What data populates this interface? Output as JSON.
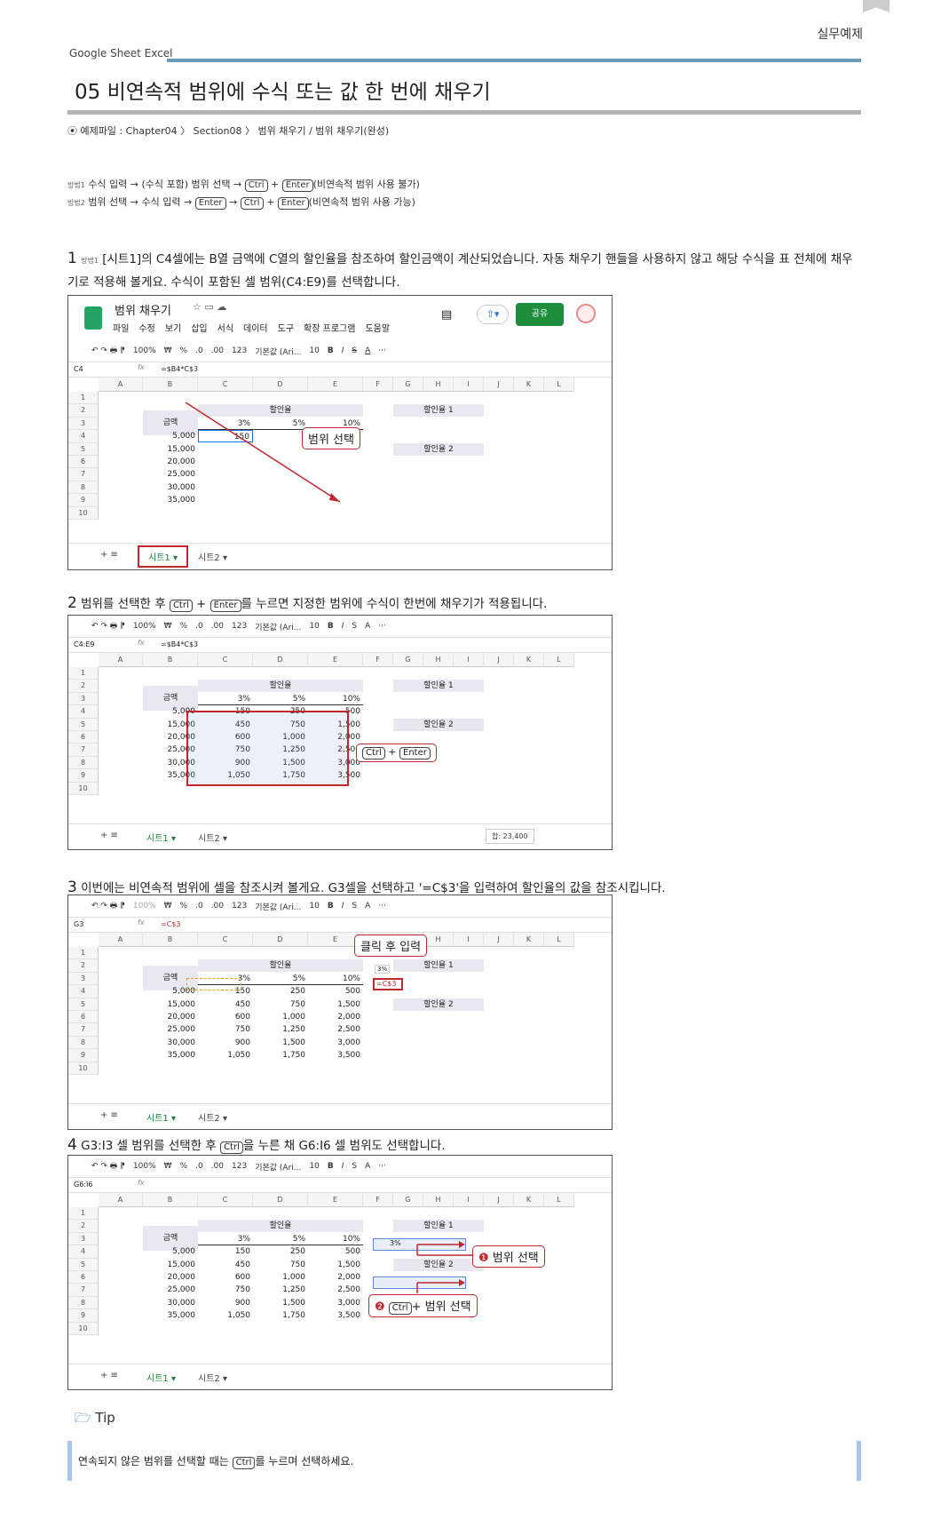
{
  "header": {
    "section": "실무예제",
    "crumb": "Google Sheet  Excel",
    "title": "05 비연속적 범위에 수식 또는 값 한 번에 채우기",
    "file": "⦿ 예제파일 : Chapter04 〉 Section08 〉 범위 채우기 / 범위 채우기(완성)"
  },
  "methods": [
    {
      "tag": "방법1",
      "text1": "수식 입력 → (수식 포함) 범위 선택 →",
      "k1": "Ctrl",
      "plus": "+",
      "k2": "Enter",
      "text2": "(비연속적 범위 사용 불가)"
    },
    {
      "tag": "방법2",
      "text1": "범위 선택 → 수식 입력 →",
      "k1": "Enter",
      "arrow": "→",
      "k2": "Ctrl",
      "plus": "+",
      "k3": "Enter",
      "text2": "(비연속적 범위 사용 가능)"
    }
  ],
  "steps": [
    {
      "num": "1",
      "tag": "방법1",
      "text": "[시트1]의 C4셀에는 B열 금액에 C열의 할인율을 참조하여 할인금액이 계산되었습니다. 자동 채우기 핸들을 사용하지 않고 해당 수식을 표 전체에 채우기로 적용해 볼게요. 수식이 포함된 셀 범위(C4:E9)를 선택합니다."
    },
    {
      "num": "2",
      "a": "범위를 선택한 후",
      "k1": "Ctrl",
      "plus": "+",
      "k2": "Enter",
      "b": "를 누르면 지정한 범위에 수식이 한번에 채우기가 적용됩니다."
    },
    {
      "num": "3",
      "text": "이번에는 비연속적 범위에 셀을 참조시켜 볼게요. G3셀을 선택하고 '=C$3'을 입력하여 할인율의 값을 참조시킵니다."
    },
    {
      "num": "4",
      "a": "G3:I3 셀 범위를 선택한 후",
      "k1": "Ctrl",
      "b": "을 누른 채 G6:I6 셀 범위도 선택합니다."
    }
  ],
  "app": {
    "doc_title": "범위 채우기",
    "menu": [
      "파일",
      "수정",
      "보기",
      "삽입",
      "서식",
      "데이터",
      "도구",
      "확장 프로그램",
      "도움말"
    ],
    "share": "공유",
    "zoom": "100%",
    "font": "기본값 (Ari...",
    "size": "10",
    "currency": "₩",
    "percent": "%",
    "dec1": ".0",
    "dec2": ".00",
    "num": "123"
  },
  "sheet_tabs": {
    "tab1": "시트1",
    "tab2": "시트2",
    "sum": "합: 23,400"
  },
  "cols": [
    "A",
    "B",
    "C",
    "D",
    "E",
    "F",
    "G",
    "H",
    "I",
    "J",
    "K",
    "L"
  ],
  "rows": [
    "1",
    "2",
    "3",
    "4",
    "5",
    "6",
    "7",
    "8",
    "9",
    "10"
  ],
  "table": {
    "amount_label": "금액",
    "rate_label": "할인율",
    "rates": [
      "3%",
      "5%",
      "10%"
    ],
    "amounts": [
      "5,000",
      "15,000",
      "20,000",
      "25,000",
      "30,000",
      "35,000"
    ],
    "c": [
      "150",
      "450",
      "600",
      "750",
      "900",
      "1,050"
    ],
    "d": [
      "250",
      "750",
      "1,000",
      "1,250",
      "1,500",
      "1,750"
    ],
    "e": [
      "500",
      "1,500",
      "2,000",
      "2,500",
      "3,000",
      "3,500"
    ],
    "rate1": "할인율 1",
    "rate2": "할인율 2"
  },
  "shots": [
    {
      "namebox": "C4",
      "formula": "=$B4*C$3",
      "callout": "범위 선택"
    },
    {
      "namebox": "C4:E9",
      "formula": "=$B4*C$3",
      "callout_k1": "Ctrl",
      "callout_plus": "+",
      "callout_k2": "Enter"
    },
    {
      "namebox": "G3",
      "formula": "=C$3",
      "callout": "클릭 후 입력",
      "g3": "=C$3",
      "tip3": "3%"
    },
    {
      "namebox": "G6:I6",
      "formula": "",
      "callout1_no": "❶",
      "callout1": "범위 선택",
      "callout2_no": "❷",
      "callout2_k": "Ctrl",
      "callout2": "+ 범위 선택",
      "g3": "3%"
    }
  ],
  "tip": {
    "label": "Tip",
    "text_a": "연속되지 않은 범위를 선택할 때는",
    "key": "Ctrl",
    "text_b": "를 누르며 선택하세요."
  }
}
